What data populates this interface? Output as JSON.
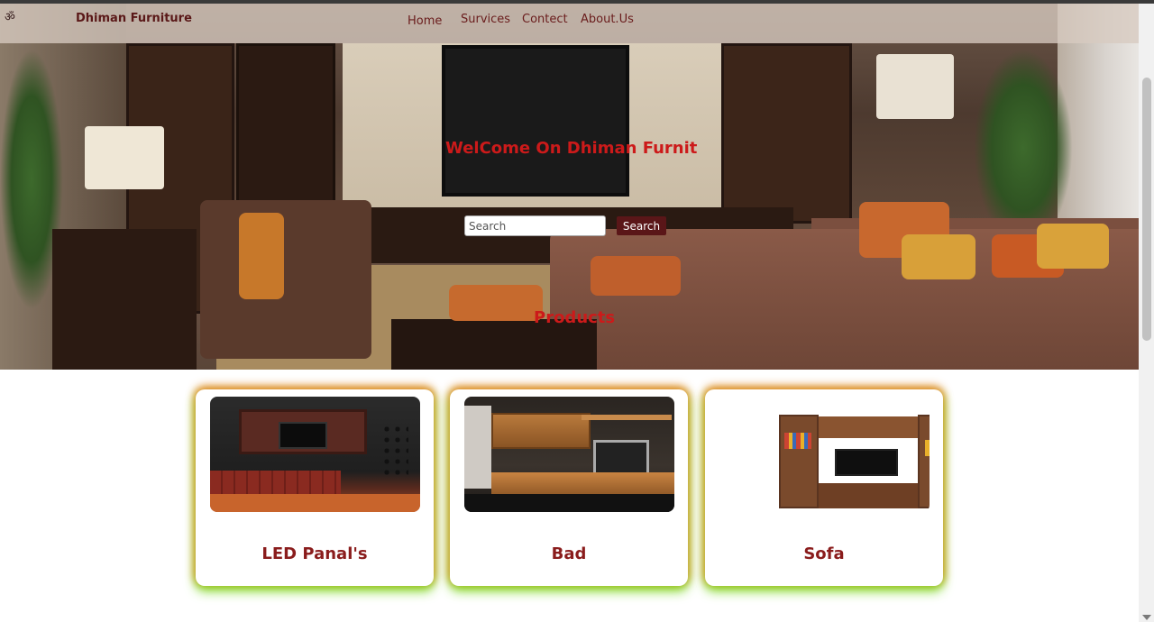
{
  "navbar": {
    "logo_icon": "om-icon",
    "brand": "Dhiman Furniture",
    "links": [
      {
        "label": "Home"
      },
      {
        "label": "Survices"
      },
      {
        "label": "Contect"
      },
      {
        "label": "About.Us"
      }
    ]
  },
  "hero": {
    "welcome": "WelCome On Dhiman Furnitur",
    "search": {
      "placeholder": "Search",
      "value": "",
      "button_label": "Search"
    },
    "products_heading": "Products"
  },
  "products": [
    {
      "title": "LED Panal's"
    },
    {
      "title": "Bad"
    },
    {
      "title": "Sofa"
    }
  ],
  "colors": {
    "accent_red": "#cc1a1a",
    "brand_maroon": "#5a1618",
    "card_title": "#8a1c1c",
    "glow_orange": "#e6821e",
    "glow_green": "#78dc1e"
  }
}
